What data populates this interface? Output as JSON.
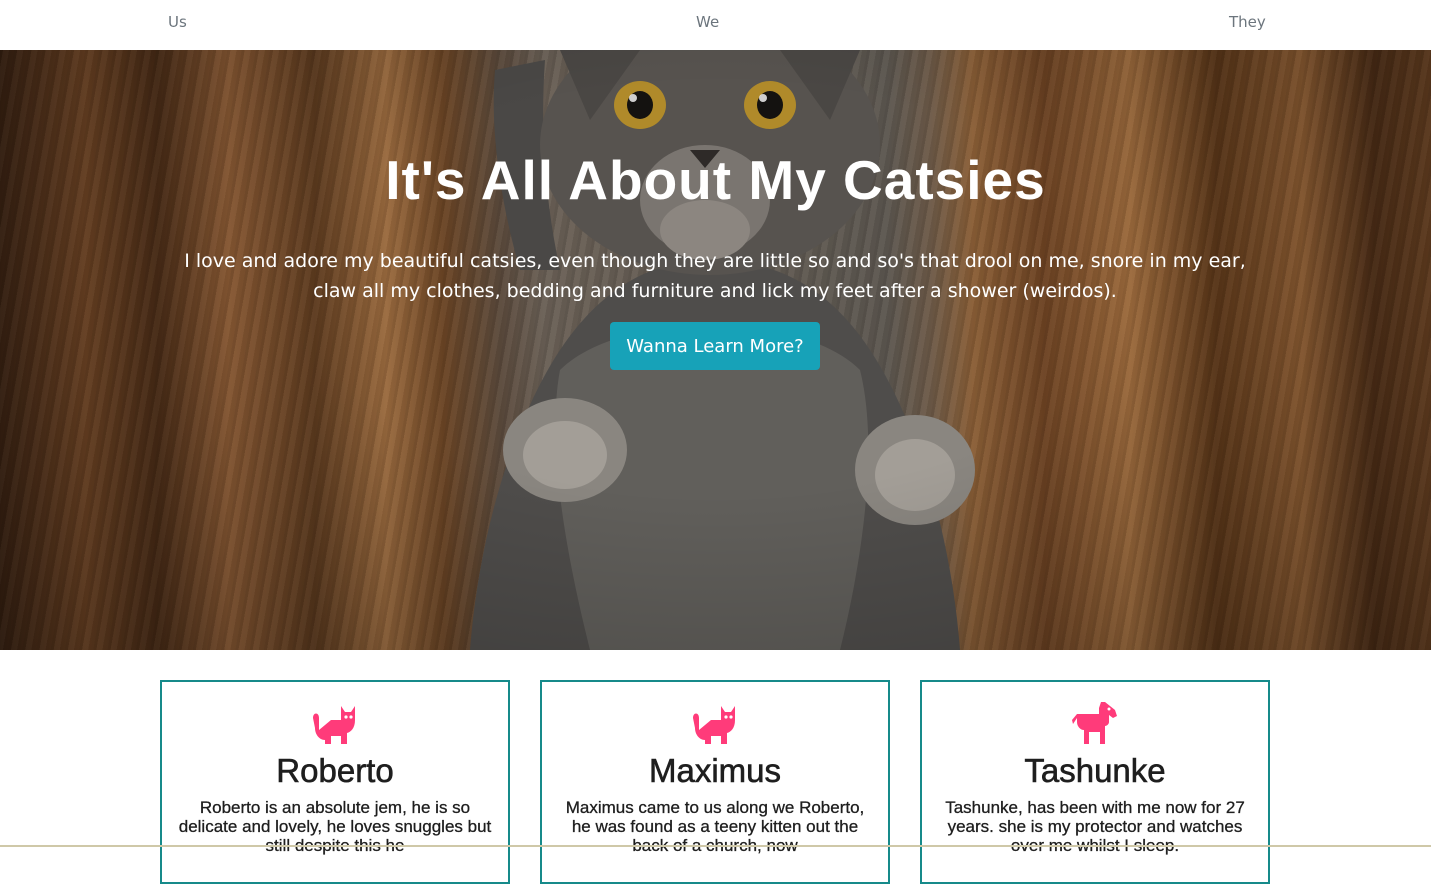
{
  "nav": {
    "items": [
      {
        "label": "Us"
      },
      {
        "label": "We"
      },
      {
        "label": "They"
      }
    ]
  },
  "hero": {
    "title": "It's All About My Catsies",
    "lead": "I love and adore my beautiful catsies, even though they are little so and so's that drool on me, snore in my ear, claw all my clothes, bedding and furniture and lick my feet after a shower (weirdos).",
    "button_label": "Wanna Learn More?",
    "button_color": "#17a2b8"
  },
  "cards": [
    {
      "icon": "cat-icon",
      "name": "Roberto",
      "text": "Roberto is an absolute jem, he is so delicate and lovely, he loves snuggles but still despite this he"
    },
    {
      "icon": "cat-icon",
      "name": "Maximus",
      "text": "Maximus came to us along we Roberto, he was found as a teeny kitten out the back of a church, now"
    },
    {
      "icon": "horse-icon",
      "name": "Tashunke",
      "text": "Tashunke, has been with me now for 27 years. she is my protector and watches over me whilst I sleep."
    }
  ],
  "colors": {
    "icon_pink": "#ff3b7a",
    "card_border": "#168a8a",
    "nav_text": "#6c757d"
  }
}
